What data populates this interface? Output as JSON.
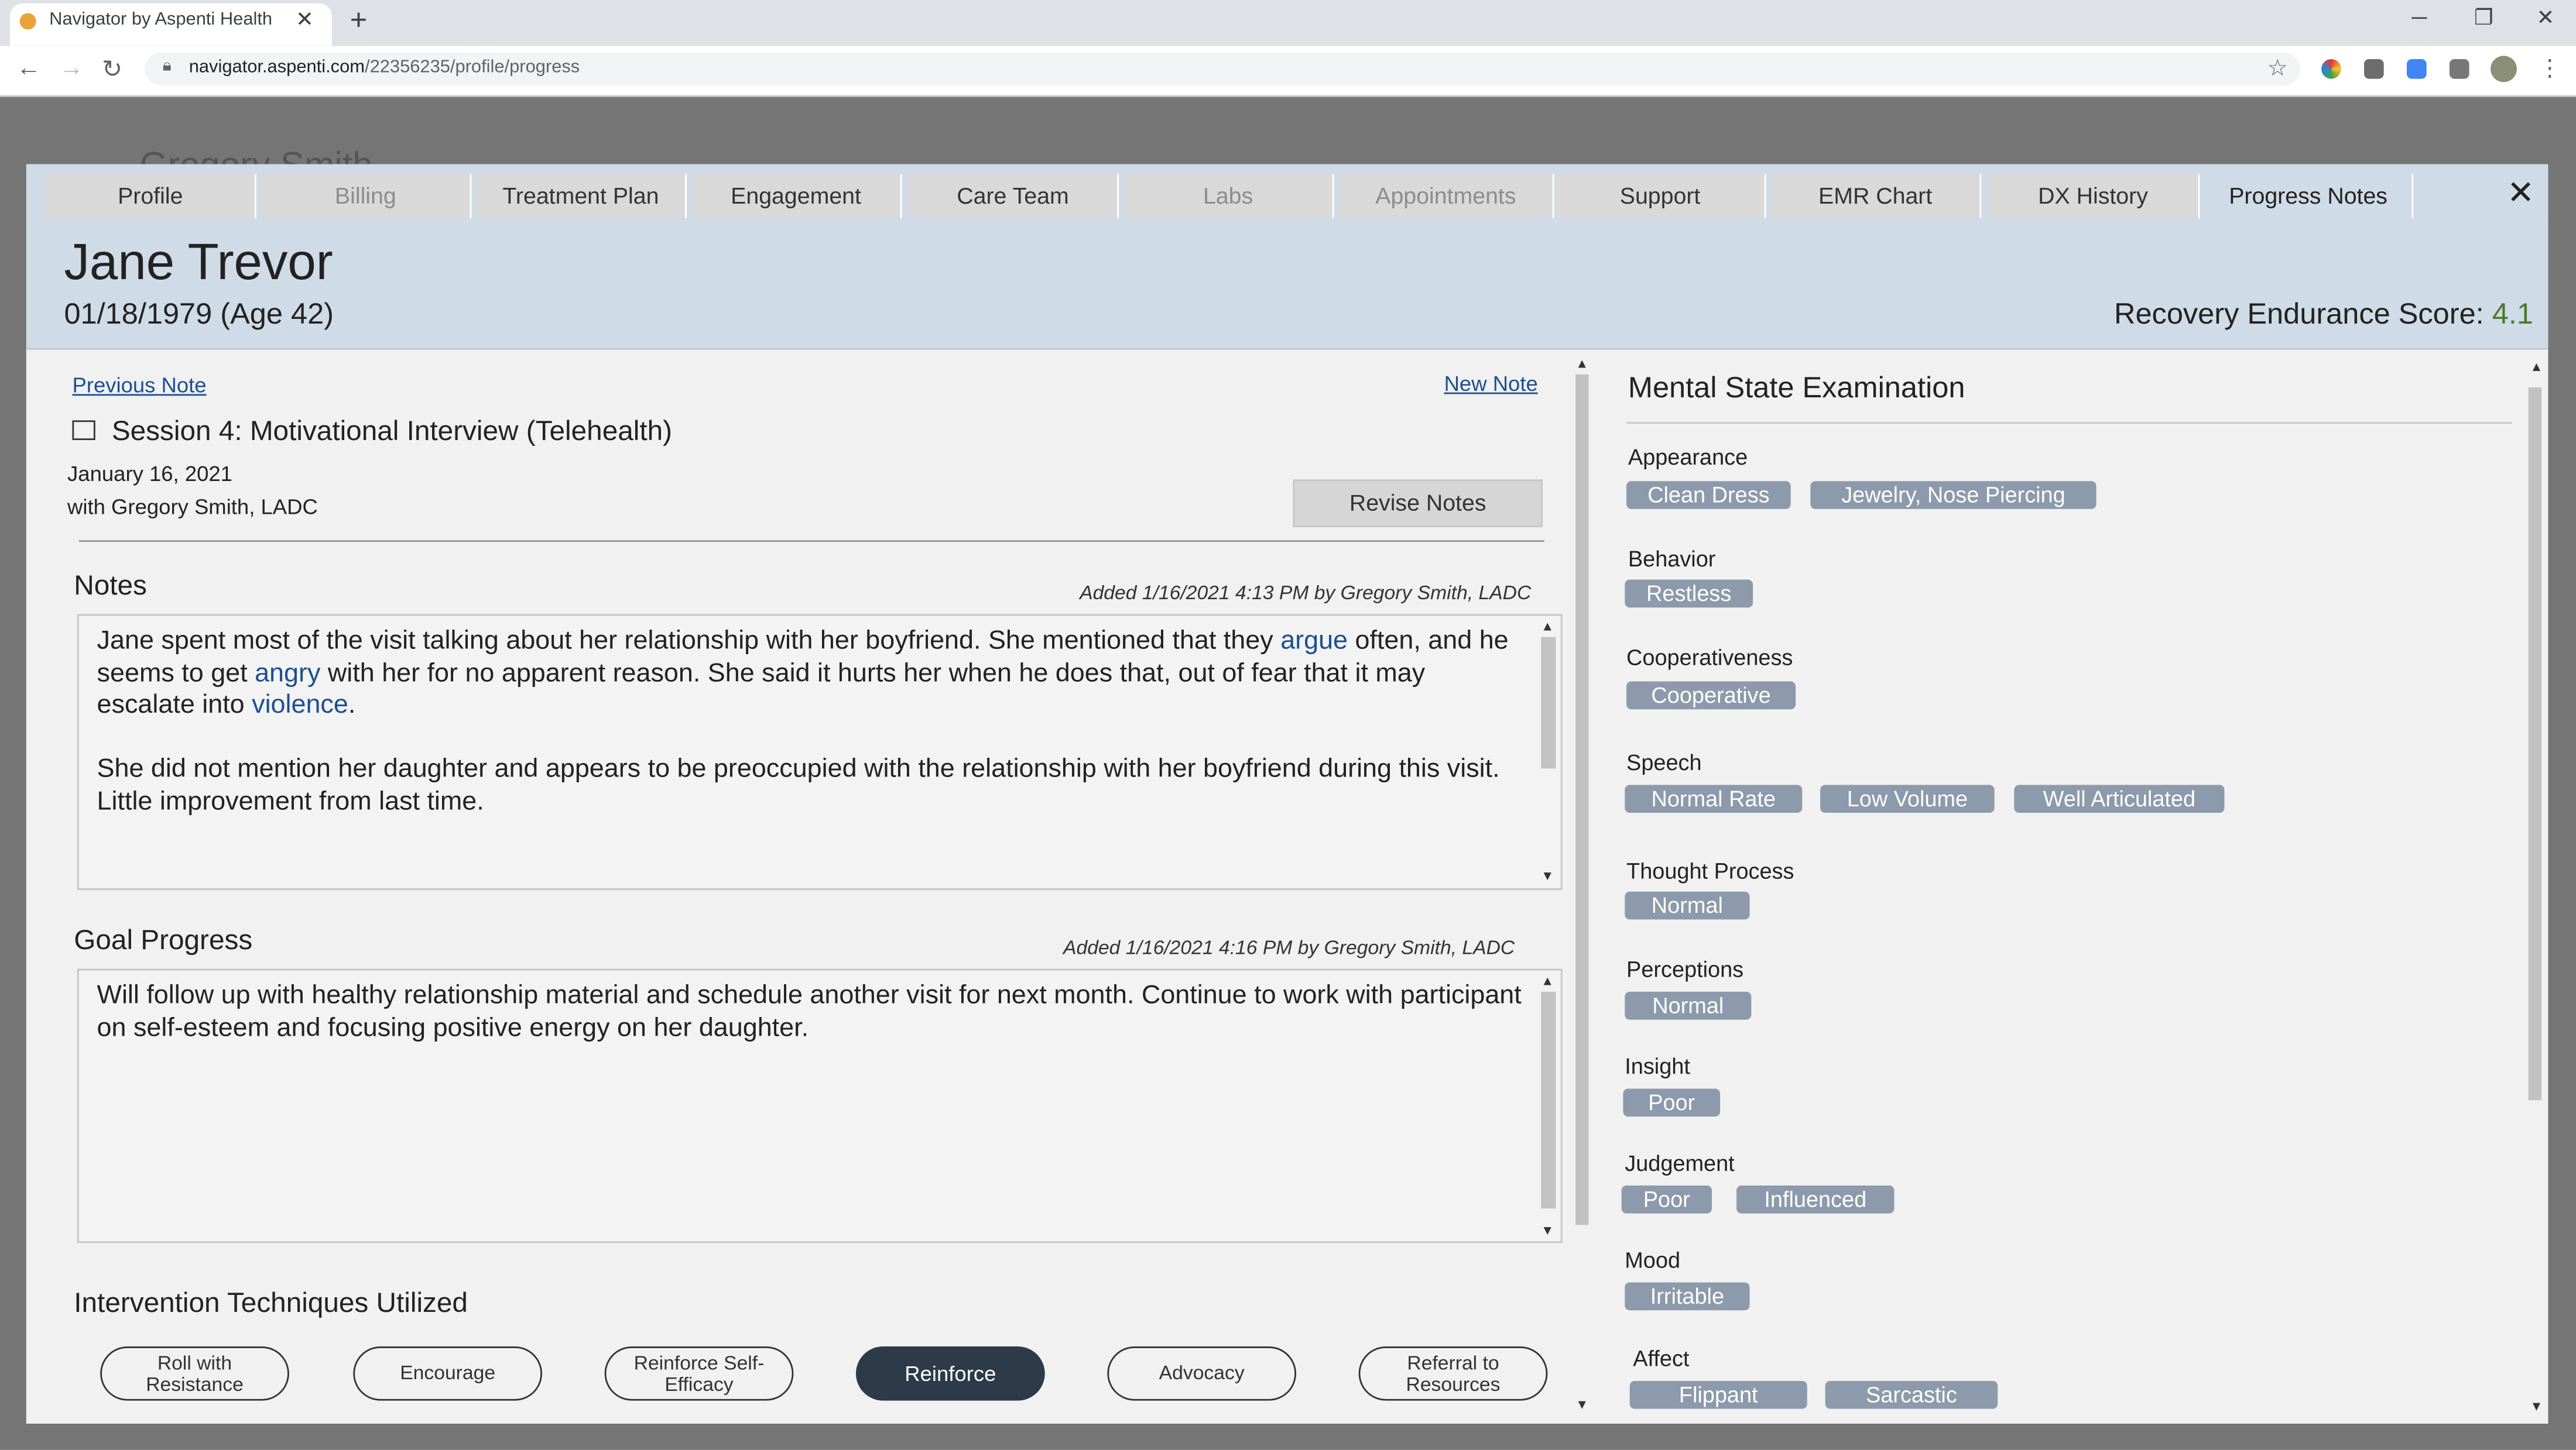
{
  "browser": {
    "tab_title": "Navigator by Aspenti Health",
    "url_host": "navigator.aspenti.com",
    "url_path": "/22356235/profile/progress"
  },
  "background": {
    "name": "Gregory Smith"
  },
  "tabs": [
    {
      "label": "Profile",
      "state": "normal"
    },
    {
      "label": "Billing",
      "state": "disabled"
    },
    {
      "label": "Treatment Plan",
      "state": "normal"
    },
    {
      "label": "Engagement",
      "state": "normal"
    },
    {
      "label": "Care Team",
      "state": "normal"
    },
    {
      "label": "Labs",
      "state": "disabled"
    },
    {
      "label": "Appointments",
      "state": "disabled"
    },
    {
      "label": "Support",
      "state": "normal"
    },
    {
      "label": "EMR Chart",
      "state": "normal"
    },
    {
      "label": "DX History",
      "state": "normal"
    },
    {
      "label": "Progress Notes",
      "state": "active"
    }
  ],
  "patient": {
    "name": "Jane Trevor",
    "dob": "01/18/1979 (Age 42)",
    "res_label": "Recovery Endurance Score:",
    "res_value": "4.1"
  },
  "note": {
    "prev": "Previous Note",
    "new": "New Note",
    "session_title": "Session 4: Motivational Interview (Telehealth)",
    "date": "January 16, 2021",
    "with": "with Gregory Smith, LADC",
    "revise": "Revise Notes",
    "notes_heading": "Notes",
    "notes_added": "Added 1/16/2021 4:13 PM by Gregory Smith, LADC",
    "notes_text": {
      "p1_a": "Jane spent most of the visit talking about her relationship with her boyfriend. She mentioned that they",
      "kw1": "argue",
      "p1_b": " often, and he seems to get ",
      "kw2": "angry",
      "p1_c": " with her for no apparent reason. She said it hurts her when he does that, out of fear that it may escalate into ",
      "kw3": "violence",
      "p1_d": ".",
      "p2": "She did not mention her daughter and appears to be preoccupied with the relationship with her boyfriend during this visit. Little improvement from last time."
    },
    "goal_heading": "Goal Progress",
    "goal_added": "Added 1/16/2021 4:16 PM by Gregory Smith, LADC",
    "goal_text": "Will follow up with healthy relationship material and schedule another visit for next month. Continue to work with participant on self-esteem and focusing positive energy on her daughter.",
    "interventions_heading": "Intervention Techniques Utilized",
    "interventions": [
      {
        "label": "Roll with Resistance",
        "active": false
      },
      {
        "label": "Encourage",
        "active": false
      },
      {
        "label": "Reinforce Self-Efficacy",
        "active": false
      },
      {
        "label": "Reinforce",
        "active": true
      },
      {
        "label": "Advocacy",
        "active": false
      },
      {
        "label": "Referral to Resources",
        "active": false
      }
    ]
  },
  "mse": {
    "title": "Mental State Examination",
    "sections": [
      {
        "label": "Appearance",
        "tags": [
          "Clean Dress",
          "Jewelry, Nose Piercing"
        ]
      },
      {
        "label": "Behavior",
        "tags": [
          "Restless"
        ]
      },
      {
        "label": "Cooperativeness",
        "tags": [
          "Cooperative"
        ]
      },
      {
        "label": "Speech",
        "tags": [
          "Normal Rate",
          "Low Volume",
          "Well Articulated"
        ]
      },
      {
        "label": "Thought Process",
        "tags": [
          "Normal"
        ]
      },
      {
        "label": "Perceptions",
        "tags": [
          "Normal"
        ]
      },
      {
        "label": "Insight",
        "tags": [
          "Poor"
        ]
      },
      {
        "label": "Judgement",
        "tags": [
          "Poor",
          "Influenced"
        ]
      },
      {
        "label": "Mood",
        "tags": [
          "Irritable"
        ]
      },
      {
        "label": "Affect",
        "tags": [
          "Flippant",
          "Sarcastic"
        ]
      }
    ]
  }
}
